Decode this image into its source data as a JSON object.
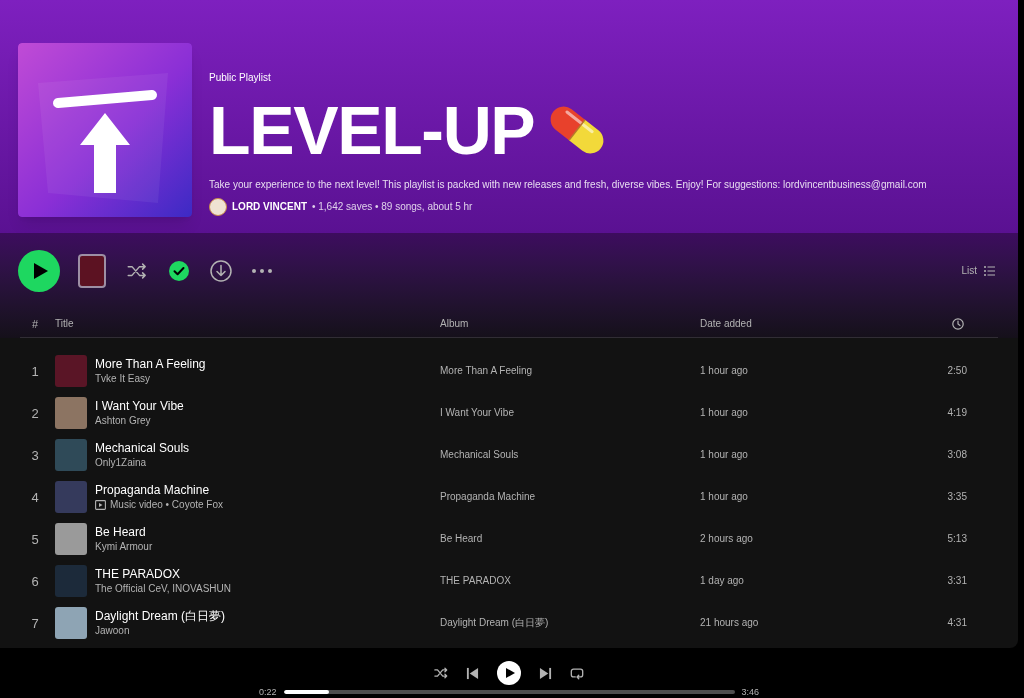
{
  "header": {
    "label": "Public Playlist",
    "title": "LEVEL-UP",
    "description": "Take your experience to the next level! This playlist is packed with new releases and fresh, diverse vibes. Enjoy! For suggestions: lordvincentbusiness@gmail.com",
    "owner": "LORD VINCENT",
    "stats": "• 1,642 saves • 89 songs, about 5 hr"
  },
  "actions": {
    "saved": true,
    "view_mode": "List"
  },
  "table": {
    "columns": [
      "#",
      "Title",
      "Album",
      "Date added"
    ],
    "rows": [
      {
        "number": "1",
        "title": "More Than A Feeling",
        "kind": "song",
        "subtitle": "Tvke It Easy",
        "album": "More Than A Feeling",
        "date_added": "1 hour ago",
        "duration": "2:50"
      },
      {
        "number": "2",
        "title": "I Want Your Vibe",
        "kind": "song",
        "subtitle": "Ashton Grey",
        "album": "I Want Your Vibe",
        "date_added": "1 hour ago",
        "duration": "4:19"
      },
      {
        "number": "3",
        "title": "Mechanical Souls",
        "kind": "song",
        "subtitle": "Only1Zaina",
        "album": "Mechanical Souls",
        "date_added": "1 hour ago",
        "duration": "3:08"
      },
      {
        "number": "4",
        "title": "Propaganda Machine",
        "kind": "video",
        "subtitle": "Music video • Coyote Fox",
        "album": "Propaganda Machine",
        "date_added": "1 hour ago",
        "duration": "3:35"
      },
      {
        "number": "5",
        "title": "Be Heard",
        "kind": "song",
        "subtitle": "Kymi Armour",
        "album": "Be Heard",
        "date_added": "2 hours ago",
        "duration": "5:13"
      },
      {
        "number": "6",
        "title": "THE PARADOX",
        "kind": "song",
        "subtitle": "The Official CeV, INOVASHUN",
        "album": "THE PARADOX",
        "date_added": "1 day ago",
        "duration": "3:31"
      },
      {
        "number": "7",
        "title": "Daylight Dream (白日夢)",
        "kind": "song",
        "subtitle": "Jawoon",
        "album": "Daylight Dream (白日夢)",
        "date_added": "21 hours ago",
        "duration": "4:31"
      }
    ]
  },
  "player": {
    "playing": false,
    "shuffle": false,
    "repeat": false,
    "elapsed": "0:22",
    "total": "3:46",
    "level": 0.1
  }
}
